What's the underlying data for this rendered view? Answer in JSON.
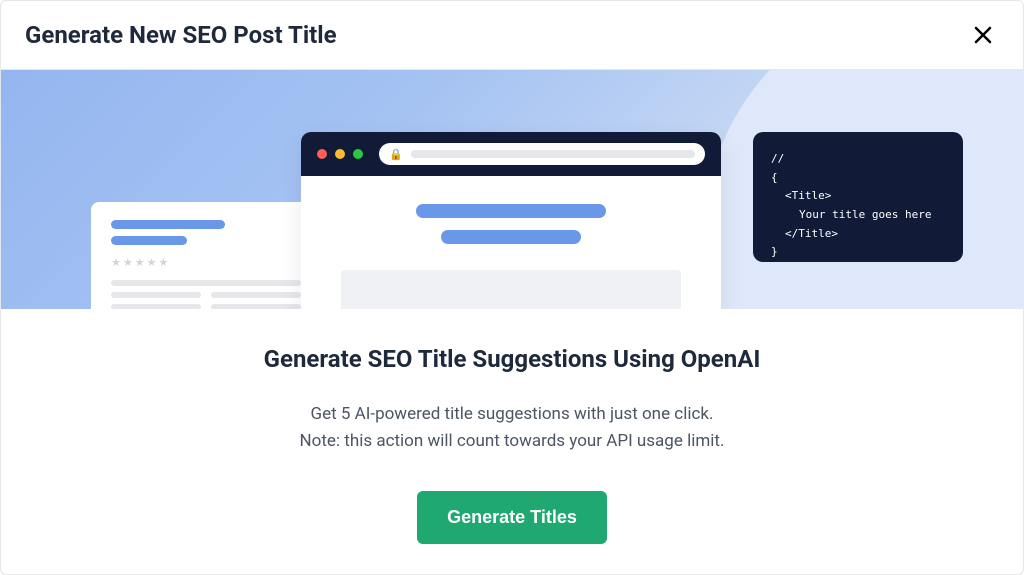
{
  "header": {
    "title": "Generate New SEO Post Title"
  },
  "illustration": {
    "code_card": {
      "line1": "//",
      "line2": "{",
      "line3": "<Title>",
      "line4": "Your title goes here",
      "line5": "</Title>",
      "line6": "}"
    }
  },
  "body": {
    "heading": "Generate SEO Title Suggestions Using OpenAI",
    "text_line1": "Get 5 AI-powered title suggestions with just one click.",
    "text_line2": "Note: this action will count towards your API usage limit.",
    "button_label": "Generate Titles"
  }
}
